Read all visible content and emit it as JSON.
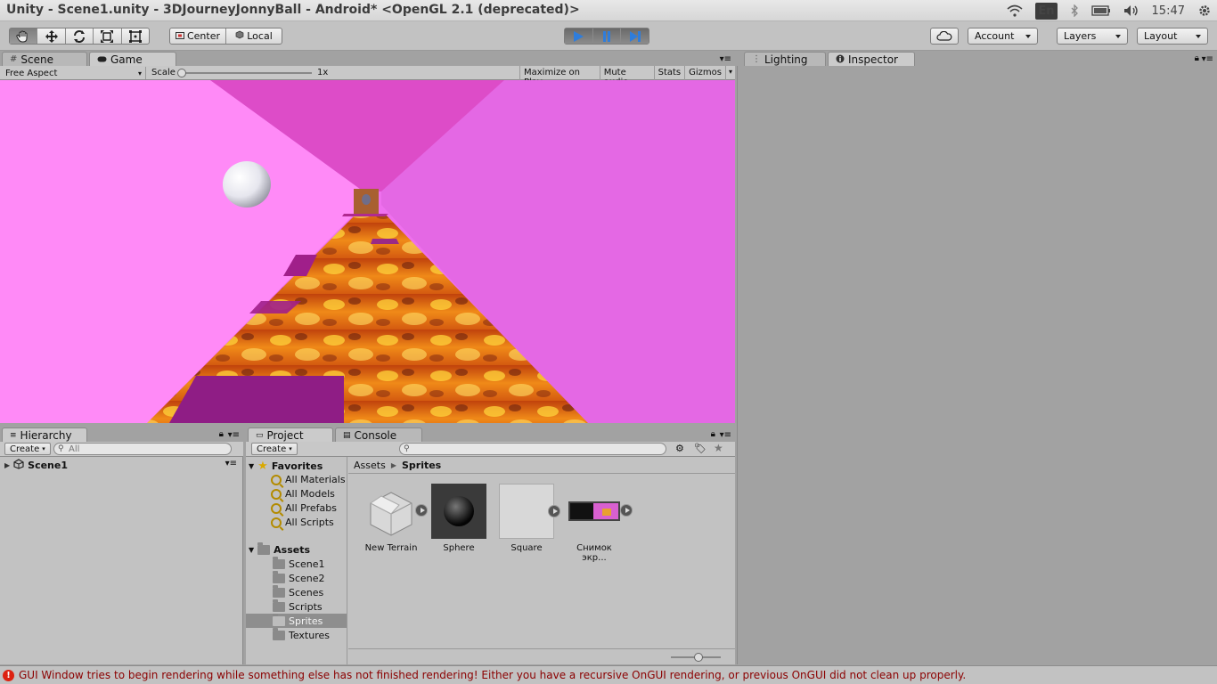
{
  "window": {
    "title": "Unity - Scene1.unity - 3DJourneyJonnyBall - Android* <OpenGL 2.1 (deprecated)>"
  },
  "tray": {
    "lang": "En",
    "clock": "15:47"
  },
  "toolbar": {
    "pivot_center": "Center",
    "pivot_local": "Local",
    "account": "Account",
    "layers": "Layers",
    "layout": "Layout"
  },
  "tabs": {
    "scene": "Scene",
    "game": "Game",
    "lighting": "Lighting",
    "inspector": "Inspector",
    "hierarchy": "Hierarchy",
    "project": "Project",
    "console": "Console"
  },
  "game_bar": {
    "aspect": "Free Aspect",
    "scale_label": "Scale",
    "scale_value": "1x",
    "maximize": "Maximize on Play",
    "mute": "Mute audio",
    "stats": "Stats",
    "gizmos": "Gizmos"
  },
  "hierarchy": {
    "create": "Create",
    "search_placeholder": "All",
    "scene_name": "Scene1"
  },
  "project": {
    "create": "Create",
    "favorites_label": "Favorites",
    "favorites": [
      "All Materials",
      "All Models",
      "All Prefabs",
      "All Scripts"
    ],
    "assets_label": "Assets",
    "folders": [
      "Scene1",
      "Scene2",
      "Scenes",
      "Scripts",
      "Sprites",
      "Textures"
    ],
    "selected_folder": "Sprites",
    "breadcrumb_root": "Assets",
    "breadcrumb_current": "Sprites",
    "assets": [
      "New Terrain",
      "Sphere",
      "Square",
      "Снимок экр..."
    ]
  },
  "status": {
    "message": "GUI Window tries to begin rendering while something else has not finished rendering! Either you have a recursive OnGUI rendering, or previous OnGUI did not clean up properly."
  },
  "colors": {
    "accent_play": "#2f7ddb",
    "error": "#d21f1f",
    "game_left_wall": "#ff8af7",
    "game_right_wall": "#e766e7"
  },
  "icons": [
    "hand-icon",
    "move-icon",
    "rotate-icon",
    "scale-icon",
    "rect-icon",
    "play-icon",
    "pause-icon",
    "step-icon",
    "cloud-icon",
    "lock-icon",
    "search-icon",
    "folder-icon",
    "star-icon"
  ]
}
